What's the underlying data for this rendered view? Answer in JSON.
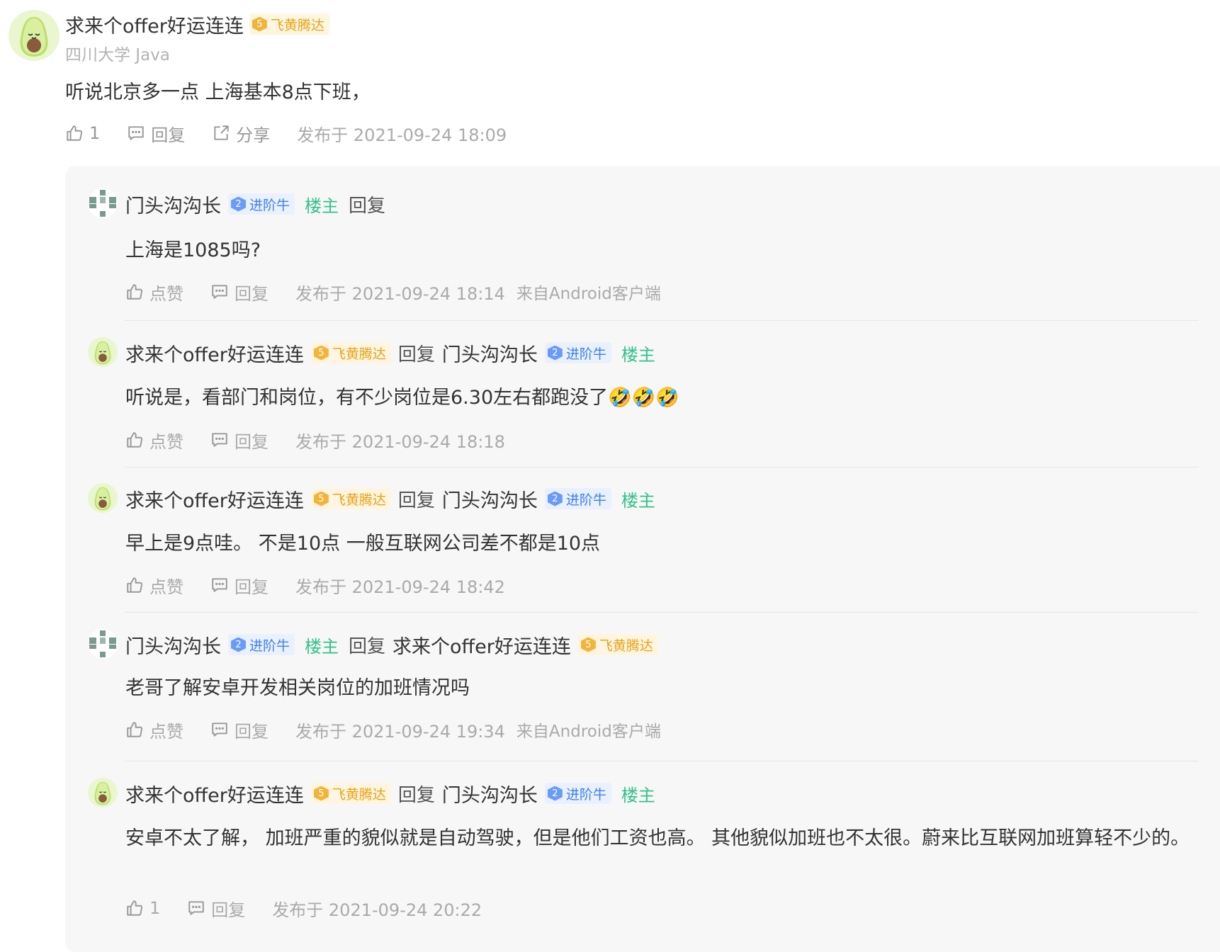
{
  "main": {
    "author": "求来个offer好运连连",
    "badge_level": "5",
    "badge_label": "飞黄腾达",
    "school": "四川大学 Java",
    "content": "听说北京多一点 上海基本8点下班，",
    "likes": "1",
    "reply_label": "回复",
    "share_label": "分享",
    "time": "发布于 2021-09-24 18:09"
  },
  "replies": [
    {
      "author": "门头沟沟长",
      "badge_level": "2",
      "badge_label": "进阶牛",
      "op_label": "楼主",
      "reply_word": "回复",
      "content": "上海是1085吗?",
      "like_label": "点赞",
      "reply_label": "回复",
      "time": "发布于 2021-09-24 18:14",
      "source": "来自Android客户端"
    },
    {
      "author": "求来个offer好运连连",
      "badge_level": "5",
      "badge_label": "飞黄腾达",
      "reply_word": "回复",
      "target": "门头沟沟长",
      "target_badge_level": "2",
      "target_badge_label": "进阶牛",
      "target_op_label": "楼主",
      "content": "听说是，看部门和岗位，有不少岗位是6.30左右都跑没了🤣🤣🤣",
      "like_label": "点赞",
      "reply_label": "回复",
      "time": "发布于 2021-09-24 18:18"
    },
    {
      "author": "求来个offer好运连连",
      "badge_level": "5",
      "badge_label": "飞黄腾达",
      "reply_word": "回复",
      "target": "门头沟沟长",
      "target_badge_level": "2",
      "target_badge_label": "进阶牛",
      "target_op_label": "楼主",
      "content": "早上是9点哇。 不是10点 一般互联网公司差不都是10点",
      "like_label": "点赞",
      "reply_label": "回复",
      "time": "发布于 2021-09-24 18:42"
    },
    {
      "author": "门头沟沟长",
      "badge_level": "2",
      "badge_label": "进阶牛",
      "op_label": "楼主",
      "reply_word": "回复",
      "target": "求来个offer好运连连",
      "target_badge_level": "5",
      "target_badge_label": "飞黄腾达",
      "content": "老哥了解安卓开发相关岗位的加班情况吗",
      "like_label": "点赞",
      "reply_label": "回复",
      "time": "发布于 2021-09-24 19:34",
      "source": "来自Android客户端"
    },
    {
      "author": "求来个offer好运连连",
      "badge_level": "5",
      "badge_label": "飞黄腾达",
      "reply_word": "回复",
      "target": "门头沟沟长",
      "target_badge_level": "2",
      "target_badge_label": "进阶牛",
      "target_op_label": "楼主",
      "content": "安卓不太了解， 加班严重的貌似就是自动驾驶，但是他们工资也高。 其他貌似加班也不太很。蔚来比互联网加班算轻不少的。",
      "like_label": "1",
      "reply_label": "回复",
      "time": "发布于 2021-09-24 20:22"
    }
  ],
  "colors": {
    "gold_badge": "#e8a317",
    "blue_badge": "#3d7ef7",
    "op_green": "#32c28b",
    "panel_bg": "#f7f7f7"
  },
  "icons": {
    "like": "thumbs-up-icon",
    "reply": "comment-icon",
    "share": "share-icon",
    "avatar_fruit": "avocado-avatar",
    "avatar_grid": "pixel-grid-avatar"
  }
}
